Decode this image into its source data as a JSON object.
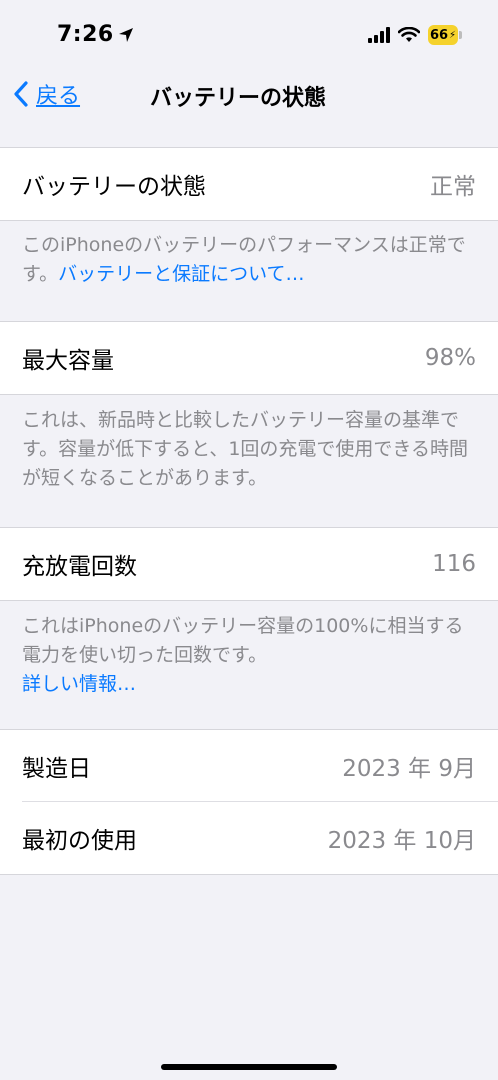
{
  "status_bar": {
    "time": "7:26",
    "battery_level": "66"
  },
  "nav": {
    "back_label": "戻る",
    "title": "バッテリーの状態"
  },
  "battery_health": {
    "label": "バッテリーの状態",
    "value": "正常",
    "footer_text": "このiPhoneのバッテリーのパフォーマンスは正常です。",
    "footer_link": "バッテリーと保証について…"
  },
  "maximum_capacity": {
    "label": "最大容量",
    "value": "98%",
    "footer_text": "これは、新品時と比較したバッテリー容量の基準です。容量が低下すると、1回の充電で使用できる時間が短くなることがあります。"
  },
  "cycle_count": {
    "label": "充放電回数",
    "value": "116",
    "footer_text": "これはiPhoneのバッテリー容量の100%に相当する電力を使い切った回数です。",
    "footer_link": "詳しい情報…"
  },
  "dates": {
    "manufacture_label": "製造日",
    "manufacture_value": "2023 年 9月",
    "first_use_label": "最初の使用",
    "first_use_value": "2023 年 10月"
  },
  "colors": {
    "accent": "#0a7aff",
    "background": "#f2f2f7",
    "secondary_text": "#8a8a8e",
    "battery": "#f5d22c"
  }
}
